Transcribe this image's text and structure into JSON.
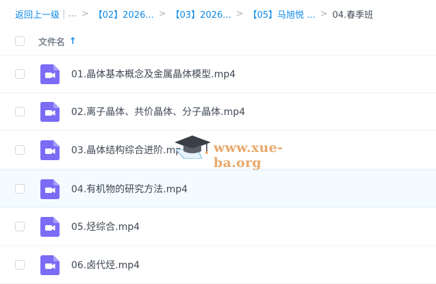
{
  "breadcrumb": {
    "back_label": "返回上一级",
    "bar": "|",
    "ellipsis": "...",
    "items": [
      "【02】2026...",
      "【03】2026...",
      "【05】马旭悦 ..."
    ],
    "current": "04.春季班",
    "separator": ">"
  },
  "header": {
    "title": "文件名",
    "sort_arrow": "↑"
  },
  "files": [
    {
      "name": "01.晶体基本概念及金属晶体模型.mp4"
    },
    {
      "name": "02.离子晶体、共价晶体、分子晶体.mp4"
    },
    {
      "name": "03.晶体结构综合进阶.mp4"
    },
    {
      "name": "04.有机物的研究方法.mp4"
    },
    {
      "name": "05.烃综合.mp4"
    },
    {
      "name": "06.卤代烃.mp4"
    }
  ],
  "watermark": {
    "text": "www.xue-ba.org"
  },
  "colors": {
    "accent": "#0a88e8",
    "video_icon": "#7b6cf6",
    "hover_row": "#f4fbff"
  }
}
